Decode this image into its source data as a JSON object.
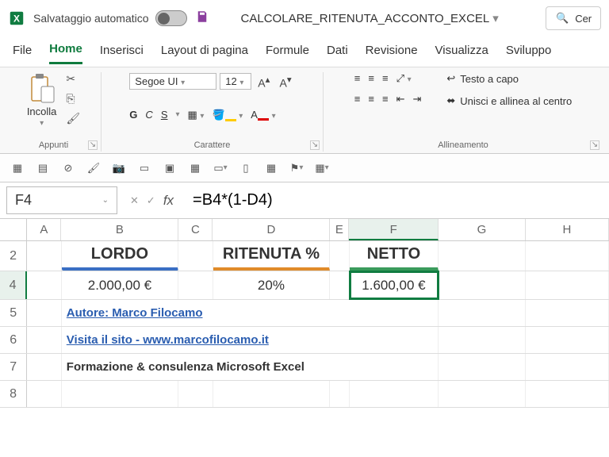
{
  "titlebar": {
    "autosave_label": "Salvataggio automatico",
    "doc_title": "CALCOLARE_RITENUTA_ACCONTO_EXCEL",
    "search_placeholder": "Cer"
  },
  "tabs": [
    "File",
    "Home",
    "Inserisci",
    "Layout di pagina",
    "Formule",
    "Dati",
    "Revisione",
    "Visualizza",
    "Sviluppo"
  ],
  "active_tab": "Home",
  "ribbon": {
    "clipboard": {
      "paste": "Incolla",
      "label": "Appunti"
    },
    "font": {
      "name": "Segoe UI",
      "size": "12",
      "bold": "G",
      "italic": "C",
      "underline": "S",
      "label": "Carattere"
    },
    "align": {
      "wrap": "Testo a capo",
      "merge": "Unisci e allinea al centro",
      "label": "Allineamento"
    }
  },
  "formula": {
    "namebox": "F4",
    "fx": "fx",
    "value": "=B4*(1-D4)"
  },
  "columns": [
    {
      "id": "A",
      "w": 45
    },
    {
      "id": "B",
      "w": 155
    },
    {
      "id": "C",
      "w": 45
    },
    {
      "id": "D",
      "w": 155
    },
    {
      "id": "E",
      "w": 25
    },
    {
      "id": "F",
      "w": 118,
      "sel": true
    },
    {
      "id": "G",
      "w": 115
    },
    {
      "id": "H",
      "w": 110
    }
  ],
  "headers": {
    "lordo": "LORDO",
    "ritenuta": "RITENUTA %",
    "netto": "NETTO"
  },
  "values": {
    "lordo": "2.000,00 €",
    "ritenuta": "20%",
    "netto": "1.600,00 €"
  },
  "rows": {
    "r5": "Autore: Marco Filocamo",
    "r6": "Visita il sito - www.marcofilocamo.it",
    "r7": "Formazione & consulenza Microsoft Excel"
  }
}
